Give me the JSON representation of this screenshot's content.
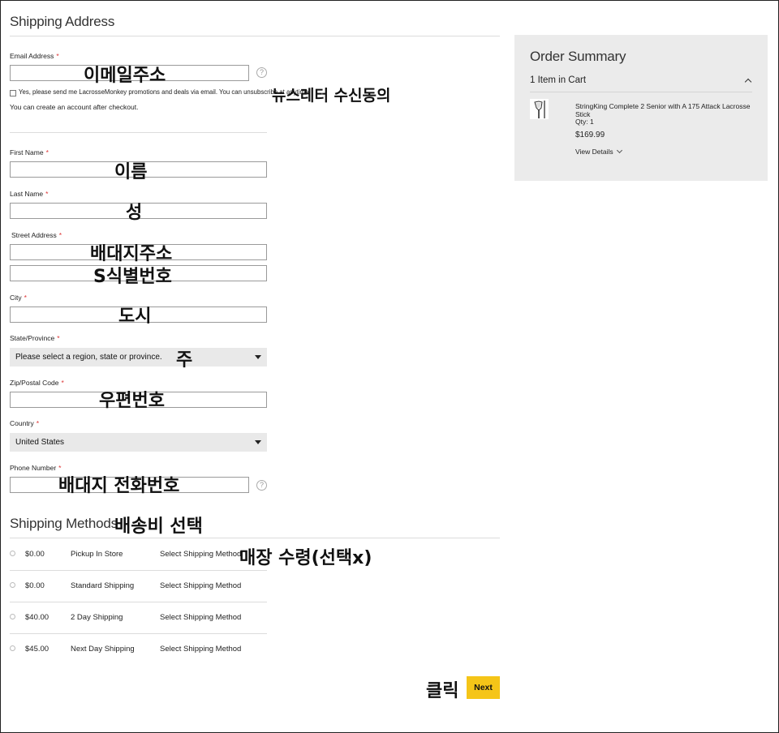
{
  "shipping": {
    "title": "Shipping Address",
    "email_label": "Email Address",
    "required_mark": "*",
    "help_glyph": "?",
    "newsletter_text": "Yes, please send me LacrosseMonkey promotions and deals via email. You can unsubscribe at anytime.",
    "account_note": "You can create an account after checkout.",
    "first_name_label": "First Name",
    "last_name_label": "Last Name",
    "street_label": "Street Address",
    "city_label": "City",
    "state_label": "State/Province",
    "state_value": "Please select a region, state or province.",
    "zip_label": "Zip/Postal Code",
    "country_label": "Country",
    "country_value": "United States",
    "phone_label": "Phone Number"
  },
  "annotations": {
    "email": "이메일주소",
    "newsletter": "뉴스레터 수신동의",
    "first_name": "이름",
    "last_name": "성",
    "street1": "배대지주소",
    "street2": "S식별번호",
    "city": "도시",
    "state": "주",
    "zip": "우편번호",
    "phone": "배대지 전화번호",
    "shipping_methods": "배송비 선택",
    "pickup": "매장 수령(선택x)",
    "click": "클릭"
  },
  "methods": {
    "title": "Shipping Methods",
    "items": [
      {
        "price": "$0.00",
        "name": "Pickup In Store",
        "action": "Select Shipping Method"
      },
      {
        "price": "$0.00",
        "name": "Standard Shipping",
        "action": "Select Shipping Method"
      },
      {
        "price": "$40.00",
        "name": "2 Day Shipping",
        "action": "Select Shipping Method"
      },
      {
        "price": "$45.00",
        "name": "Next Day Shipping",
        "action": "Select Shipping Method"
      }
    ]
  },
  "summary": {
    "title": "Order Summary",
    "cart_count": "1 Item in Cart",
    "item_name": "StringKing Complete 2 Senior with A 175 Attack Lacrosse Stick",
    "qty": "Qty: 1",
    "price": "$169.99",
    "view_details": "View Details"
  },
  "buttons": {
    "next": "Next"
  },
  "colors": {
    "next_button": "#f5c518",
    "summary_bg": "#ebebeb",
    "select_bg": "#e9e9e9",
    "required": "#dd3333"
  }
}
